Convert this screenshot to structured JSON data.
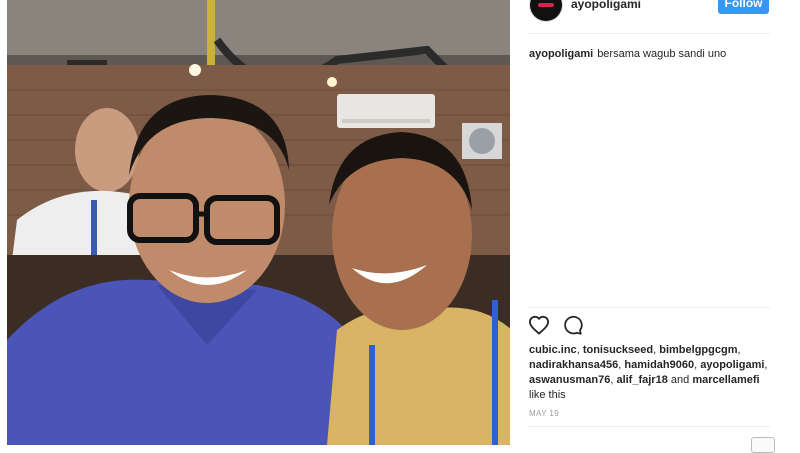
{
  "header": {
    "username": "ayopoligami",
    "follow_label": "Follow"
  },
  "caption": {
    "username": "ayopoligami",
    "text": "bersama wagub sandi uno"
  },
  "icons": {
    "like": "heart-icon",
    "comment": "comment-icon"
  },
  "likes": {
    "users": [
      "cubic.inc",
      "tonisuckseed",
      "bimbelgpgcgm",
      "nadirakhansa456",
      "hamidah9060",
      "ayopoligami",
      "aswanusman76",
      "alif_fajr18"
    ],
    "last_user": "marcellamefi",
    "and_word": "and",
    "suffix": "like this"
  },
  "date": "MAY 19",
  "colors": {
    "follow_button": "#3897f0",
    "text": "#262626",
    "muted": "#999999"
  }
}
